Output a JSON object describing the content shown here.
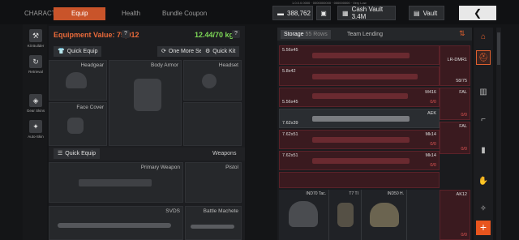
{
  "topbar": {
    "tabs": [
      "CHARACTER",
      "Equip",
      "Health",
      "Bundle Coupon"
    ],
    "active_tab": "Equip",
    "money": "388,762",
    "cash_vault": "Cash Vault 3.4M",
    "vault": "Vault",
    "back": "❮",
    "version": "1.0.0.0.0000 · 0000000000 · 000000000 · Very Low"
  },
  "leftnav": {
    "items": [
      "Kit Builder",
      "Retrieval",
      "Gear Skins",
      "Auto-Skin"
    ]
  },
  "equip": {
    "value_label": "Equipment Value: 75,012",
    "weight": "12.44/70 kg",
    "help": "?",
    "quick_equip": "Quick Equip",
    "one_more_set": "One More Set",
    "quick_kit": "Quick Kit",
    "slots": {
      "headgear": "Headgear",
      "body_armor": "Body Armor",
      "headset": "Headset",
      "face_cover": "Face Cover"
    },
    "weapons_bar": {
      "quick_equip": "Quick Equip",
      "title": "Weapons"
    },
    "primary": "Primary Weapon",
    "pistol": "Pistol",
    "bottom_left": "SVDS",
    "bottom_right": "Battle Machete"
  },
  "storage": {
    "tab_storage": "Storage",
    "rows_badge": "55 Rows",
    "tab_lending": "Team Lending",
    "rows": [
      {
        "cal": "5.56x45",
        "name": "",
        "count": ""
      },
      {
        "cal": "5.8x42",
        "name": "",
        "count": ""
      },
      {
        "cal": "5.56x45",
        "name": "M416",
        "count": "0/0"
      },
      {
        "cal": "7.62x39",
        "name": "AEK",
        "count": ""
      },
      {
        "cal": "7.62x51",
        "name": "Mk14",
        "count": "0/0"
      },
      {
        "cal": "7.62x51",
        "name": "Mk14",
        "count": "0/0"
      }
    ],
    "col2": [
      {
        "name": "LR-DMR1",
        "count": "58/75"
      },
      {
        "name": "FAL",
        "count": "0/0"
      },
      {
        "name": "FAL",
        "count": "0/0"
      },
      {
        "name": "AK12",
        "count": "0/0"
      }
    ],
    "gear": [
      {
        "label": "IND70 Tac."
      },
      {
        "label": "T7 TI"
      },
      {
        "label": "IND50 H."
      }
    ]
  },
  "filters": {
    "icons": [
      "helmet-icon",
      "gear-icon",
      "vest-icon",
      "gun-icon",
      "pistol-icon",
      "knife-icon",
      "ammo-icon",
      "hand-icon",
      "eagle-icon"
    ],
    "plus": "+"
  }
}
